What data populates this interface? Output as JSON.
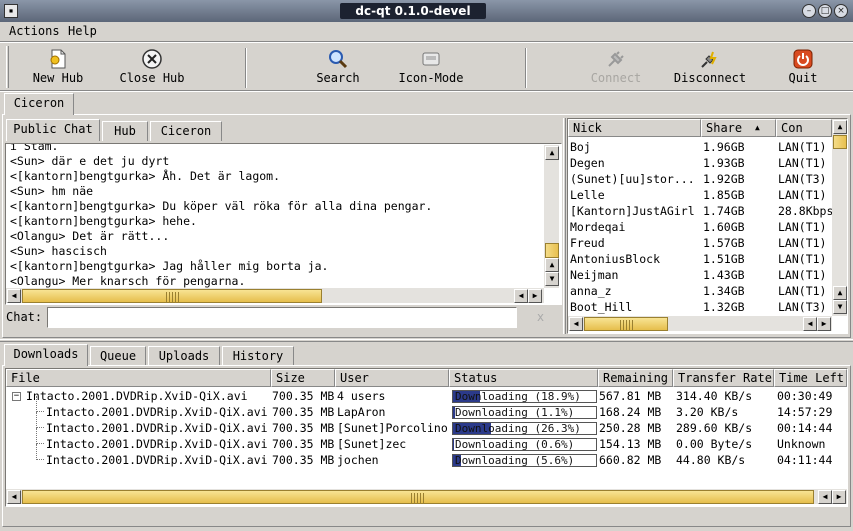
{
  "window": {
    "title": "dc-qt 0.1.0-devel"
  },
  "menu": {
    "actions": "Actions",
    "help": "Help"
  },
  "toolbar": {
    "new_hub": "New Hub",
    "close_hub": "Close Hub",
    "search": "Search",
    "icon_mode": "Icon-Mode",
    "connect": "Connect",
    "disconnect": "Disconnect",
    "quit": "Quit"
  },
  "hub_tabs": {
    "active": "Ciceron"
  },
  "chat_tabs": {
    "public_chat": "Public Chat",
    "hub": "Hub",
    "ciceron": "Ciceron"
  },
  "chat": {
    "lines": [
      "<Sun> där e det ju dyrt",
      "<[kantorn]bengtgurka> Åh. Det är lagom.",
      "<Sun> hm näe",
      "<[kantorn]bengtgurka> Du köper väl röka för alla dina pengar.",
      "<[kantorn]bengtgurka> hehe.",
      "<Olangu> Det är rätt...",
      "<Sun> hascisch",
      "<[kantorn]bengtgurka> Jag håller mig borta ja.",
      "<Olangu> Mer knarsch för pengarna."
    ],
    "top_partial": "i Stam.",
    "input_label": "Chat:",
    "input_value": "",
    "clear_glyph": "x"
  },
  "users": {
    "headers": {
      "nick": "Nick",
      "share": "Share",
      "con": "Con"
    },
    "rows": [
      {
        "nick": "Boj",
        "share": "1.96GB",
        "con": "LAN(T1)"
      },
      {
        "nick": "Degen",
        "share": "1.93GB",
        "con": "LAN(T1)"
      },
      {
        "nick": "(Sunet)[uu]stor...",
        "share": "1.92GB",
        "con": "LAN(T3)"
      },
      {
        "nick": "Lelle",
        "share": "1.85GB",
        "con": "LAN(T1)"
      },
      {
        "nick": "[Kantorn]JustAGirl",
        "share": "1.74GB",
        "con": "28.8Kbps"
      },
      {
        "nick": "Mordeqai",
        "share": "1.60GB",
        "con": "LAN(T1)"
      },
      {
        "nick": "Freud",
        "share": "1.57GB",
        "con": "LAN(T1)"
      },
      {
        "nick": "AntoniusBlock",
        "share": "1.51GB",
        "con": "LAN(T1)"
      },
      {
        "nick": "Neijman",
        "share": "1.43GB",
        "con": "LAN(T1)"
      },
      {
        "nick": "anna_z",
        "share": "1.34GB",
        "con": "LAN(T1)"
      },
      {
        "nick": "Boot_Hill",
        "share": "1.32GB",
        "con": "LAN(T3)"
      }
    ]
  },
  "transfer_tabs": {
    "downloads": "Downloads",
    "queue": "Queue",
    "uploads": "Uploads",
    "history": "History"
  },
  "downloads": {
    "headers": {
      "file": "File",
      "size": "Size",
      "user": "User",
      "status": "Status",
      "remaining": "Remaining",
      "rate": "Transfer Rate",
      "time_left": "Time Left"
    },
    "rows": [
      {
        "file": "Intacto.2001.DVDRip.XviD-QiX.avi",
        "size": "700.35 MB",
        "user": "4 users",
        "status": "Downloading (18.9%)",
        "progress": 0.189,
        "remaining": "567.81 MB",
        "rate": "314.40 KB/s",
        "time_left": "00:30:49",
        "parent": true
      },
      {
        "file": "Intacto.2001.DVDRip.XviD-QiX.avi",
        "size": "700.35 MB",
        "user": "LapAron",
        "status": "Downloading (1.1%)",
        "progress": 0.011,
        "remaining": "168.24 MB",
        "rate": "3.20 KB/s",
        "time_left": "14:57:29",
        "parent": false
      },
      {
        "file": "Intacto.2001.DVDRip.XviD-QiX.avi",
        "size": "700.35 MB",
        "user": "[Sunet]Porcolino",
        "status": "Downloading (26.3%)",
        "progress": 0.263,
        "remaining": "250.28 MB",
        "rate": "289.60 KB/s",
        "time_left": "00:14:44",
        "parent": false
      },
      {
        "file": "Intacto.2001.DVDRip.XviD-QiX.avi",
        "size": "700.35 MB",
        "user": "[Sunet]zec",
        "status": "Downloading (0.6%)",
        "progress": 0.006,
        "remaining": "154.13 MB",
        "rate": "0.00 Byte/s",
        "time_left": "Unknown",
        "parent": false
      },
      {
        "file": "Intacto.2001.DVDRip.XviD-QiX.avi",
        "size": "700.35 MB",
        "user": "jochen",
        "status": "Downloading (5.6%)",
        "progress": 0.056,
        "remaining": "660.82 MB",
        "rate": "44.80 KB/s",
        "time_left": "04:11:44",
        "parent": false
      }
    ]
  },
  "colors": {
    "progress": "#2b3a8a",
    "scroll_thumb": "#e8c050",
    "window_bg": "#d6d3ce"
  }
}
